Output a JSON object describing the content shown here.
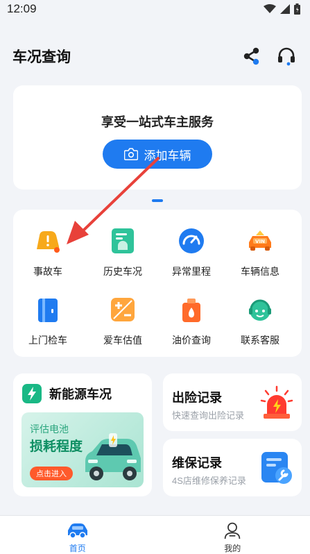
{
  "status_bar": {
    "time": "12:09"
  },
  "header": {
    "title": "车况查询"
  },
  "banner": {
    "title": "享受一站式车主服务",
    "add_car_label": "添加车辆"
  },
  "services": [
    {
      "label": "事故车",
      "icon": "accident-car-icon"
    },
    {
      "label": "历史车况",
      "icon": "history-report-icon"
    },
    {
      "label": "异常里程",
      "icon": "odometer-icon"
    },
    {
      "label": "车辆信息",
      "icon": "vin-car-icon"
    },
    {
      "label": "上门检车",
      "icon": "door-inspection-icon"
    },
    {
      "label": "爱车估值",
      "icon": "valuation-icon"
    },
    {
      "label": "油价查询",
      "icon": "fuel-price-icon"
    },
    {
      "label": "联系客服",
      "icon": "customer-service-icon"
    }
  ],
  "ev_card": {
    "title": "新能源车况",
    "subtitle": "评估电池",
    "headline": "损耗程度",
    "button": "点击进入"
  },
  "insurance_card": {
    "title": "出险记录",
    "subtitle": "快速查询出险记录"
  },
  "maintenance_card": {
    "title": "维保记录",
    "subtitle": "4S店维修保养记录"
  },
  "tabbar": {
    "home": "首页",
    "mine": "我的"
  },
  "colors": {
    "accent": "#1f7bf0",
    "page_bg": "#f2f4f8",
    "arrow": "#e8413a"
  }
}
